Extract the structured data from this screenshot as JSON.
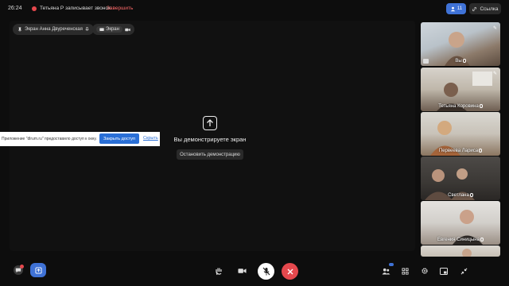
{
  "topbar": {
    "time": "26:24",
    "recording_text": "Тетьяна Р записывает звонок",
    "stop_label": "Завершить",
    "participants_count": "11",
    "link_label": "Ссылка"
  },
  "stage": {
    "screen_pill_label": "Экран Анна Двуреченская",
    "screen_pill2_label": "Экран",
    "share_title": "Вы демонстрируете экран",
    "stop_share_label": "Остановить демонстрацию"
  },
  "notice": {
    "text": "Приложение \"dlrum.ru\" предоставило доступ к окну.",
    "close_access_label": "Закрыть доступ",
    "hide_label": "Скрыть"
  },
  "tiles": [
    {
      "name": "Вы"
    },
    {
      "name": "Тетьяна Коровина"
    },
    {
      "name": "Первеева Лариса"
    },
    {
      "name": "Светлана"
    },
    {
      "name": "Евгения Синицына"
    },
    {
      "name": ""
    }
  ],
  "colors": {
    "accent": "#3f72d6",
    "danger": "#e5484d"
  }
}
